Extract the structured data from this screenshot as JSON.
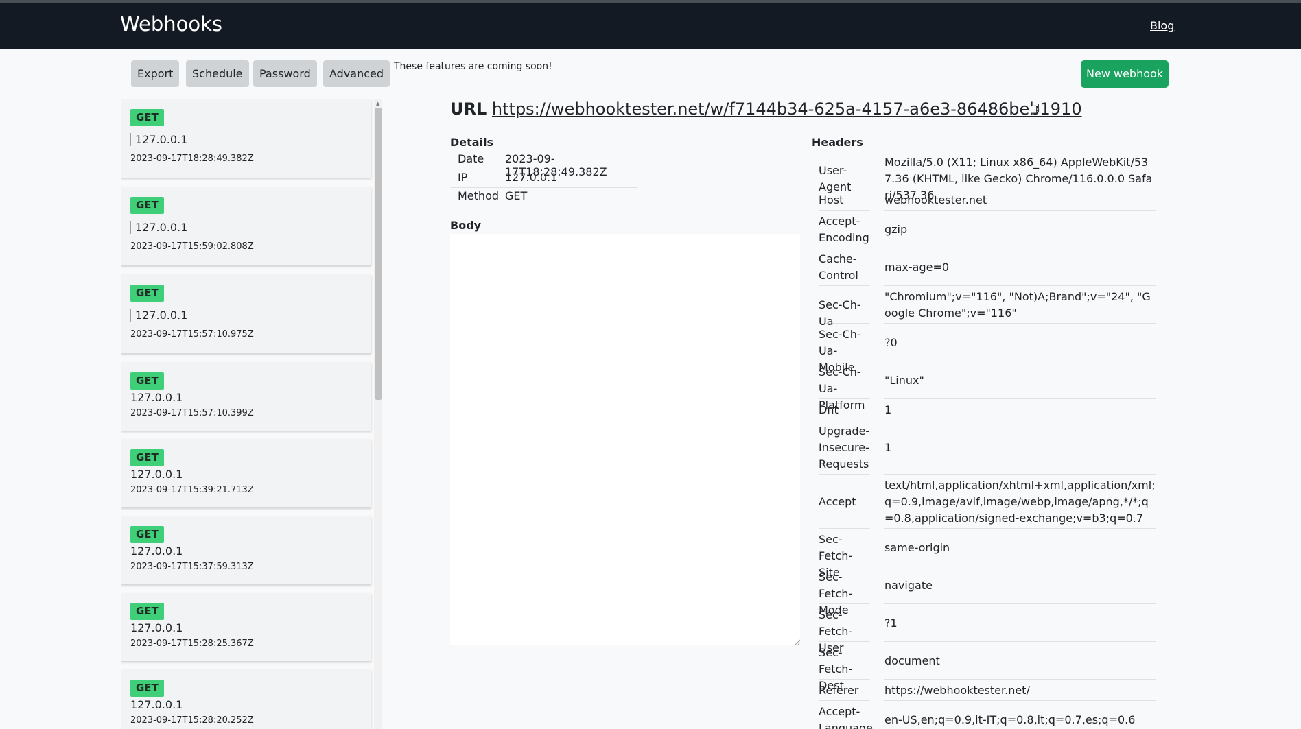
{
  "navbar": {
    "brand": "Webhooks",
    "blog": "Blog"
  },
  "toolbar": {
    "export": "Export",
    "schedule": "Schedule",
    "password": "Password",
    "advanced": "Advanced",
    "coming_soon": "These features are coming soon!",
    "new_webhook": "New webhook"
  },
  "requests": [
    {
      "method": "GET",
      "ip": "127.0.0.1",
      "time": "2023-09-17T18:28:49.382Z"
    },
    {
      "method": "GET",
      "ip": "127.0.0.1",
      "time": "2023-09-17T15:59:02.808Z"
    },
    {
      "method": "GET",
      "ip": "127.0.0.1",
      "time": "2023-09-17T15:57:10.975Z"
    },
    {
      "method": "GET",
      "ip": "127.0.0.1",
      "time": "2023-09-17T15:57:10.399Z"
    },
    {
      "method": "GET",
      "ip": "127.0.0.1",
      "time": "2023-09-17T15:39:21.713Z"
    },
    {
      "method": "GET",
      "ip": "127.0.0.1",
      "time": "2023-09-17T15:37:59.313Z"
    },
    {
      "method": "GET",
      "ip": "127.0.0.1",
      "time": "2023-09-17T15:28:25.367Z"
    },
    {
      "method": "GET",
      "ip": "127.0.0.1",
      "time": "2023-09-17T15:28:20.252Z"
    }
  ],
  "url": {
    "label": "URL",
    "value": "https://webhooktester.net/w/f7144b34-625a-4157-a6e3-86486beb1910"
  },
  "details": {
    "title": "Details",
    "date_label": "Date",
    "date": "2023-09-17T18:28:49.382Z",
    "ip_label": "IP",
    "ip": "127.0.0.1",
    "method_label": "Method",
    "method": "GET"
  },
  "body": {
    "title": "Body"
  },
  "headers": {
    "title": "Headers",
    "rows": [
      {
        "key": "User-Agent",
        "value": "Mozilla/5.0 (X11; Linux x86_64) AppleWebKit/537.36 (KHTML, like Gecko) Chrome/116.0.0.0 Safari/537.36"
      },
      {
        "key": "Host",
        "value": "webhooktester.net"
      },
      {
        "key": "Accept-Encoding",
        "value": "gzip"
      },
      {
        "key": "Cache-Control",
        "value": "max-age=0"
      },
      {
        "key": "Sec-Ch-Ua",
        "value": "\"Chromium\";v=\"116\", \"Not)A;Brand\";v=\"24\", \"Google Chrome\";v=\"116\""
      },
      {
        "key": "Sec-Ch-Ua-Mobile",
        "value": "?0"
      },
      {
        "key": "Sec-Ch-Ua-Platform",
        "value": "\"Linux\""
      },
      {
        "key": "Dnt",
        "value": "1"
      },
      {
        "key": "Upgrade-Insecure-Requests",
        "value": "1"
      },
      {
        "key": "Accept",
        "value": "text/html,application/xhtml+xml,application/xml;q=0.9,image/avif,image/webp,image/apng,*/*;q=0.8,application/signed-exchange;v=b3;q=0.7"
      },
      {
        "key": "Sec-Fetch-Site",
        "value": "same-origin"
      },
      {
        "key": "Sec-Fetch-Mode",
        "value": "navigate"
      },
      {
        "key": "Sec-Fetch-User",
        "value": "?1"
      },
      {
        "key": "Sec-Fetch-Dest",
        "value": "document"
      },
      {
        "key": "Referer",
        "value": "https://webhooktester.net/"
      },
      {
        "key": "Accept-Language",
        "value": "en-US,en;q=0.9,it-IT;q=0.8,it;q=0.7,es;q=0.6"
      }
    ]
  }
}
